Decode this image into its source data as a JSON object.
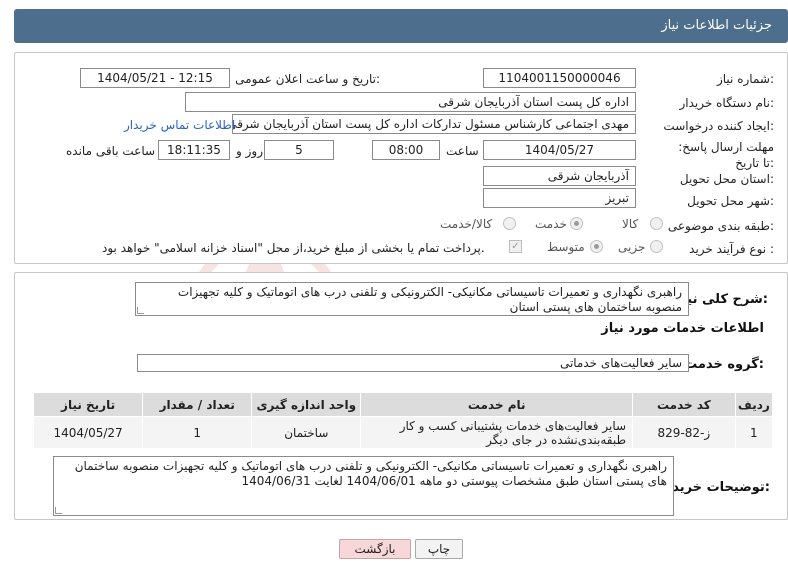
{
  "header": {
    "title": "جزئیات اطلاعات نیاز"
  },
  "form": {
    "need_number_label": "شماره نیاز:",
    "need_number": "1104001150000046",
    "announce_label": "تاریخ و ساعت اعلان عمومی:",
    "announce_value": "1404/05/21 - 12:15",
    "buyer_org_label": "نام دستگاه خریدار:",
    "buyer_org": "اداره کل پست استان آذربایجان شرقی",
    "requester_label": "ایجاد کننده درخواست:",
    "requester": "مهدی اجتماعی کارشناس مسئول تدارکات اداره کل پست استان آذربایجان شرقی",
    "buyer_contact_link": "اطلاعات تماس خریدار",
    "deadline_label": "مهلت ارسال پاسخ: تا تاریخ:",
    "deadline_date": "1404/05/27",
    "time_label": "ساعت",
    "deadline_time": "08:00",
    "days_value": "5",
    "days_label": "روز و",
    "remaining_time": "18:11:35",
    "remaining_label": "ساعت باقی مانده",
    "province_label": "استان محل تحویل:",
    "province": "آذربایجان شرقی",
    "city_label": "شهر محل تحویل:",
    "city": "تبریز",
    "category_label": "طبقه بندی موضوعی:",
    "category_options": [
      "کالا",
      "خدمت",
      "کالا/خدمت"
    ],
    "category_selected": "خدمت",
    "process_label": "نوع فرآیند خرید :",
    "process_options": [
      "جزیی",
      "متوسط"
    ],
    "process_selected": "متوسط",
    "payment_note": "پرداخت تمام یا بخشی از مبلغ خرید،از محل \"اسناد خزانه اسلامی\" خواهد بود."
  },
  "summary": {
    "label": "شرح کلی نیاز:",
    "text": "راهبری  نگهداری و تعمیرات تاسیساتی مکانیکی- الکترونیکی و تلفنی  درب های اتوماتیک و کلیه تجهیزات منصوبه ساختمان های پستی استان"
  },
  "services": {
    "section_title": "اطلاعات خدمات مورد نیاز",
    "group_label": "گروه خدمت:",
    "group_value": "سایر فعالیت‌های خدماتی",
    "columns": [
      "ردیف",
      "کد خدمت",
      "نام خدمت",
      "واحد اندازه گیری",
      "تعداد / مقدار",
      "تاریخ نیاز"
    ],
    "rows": [
      [
        "1",
        "ز-82-829",
        "سایر فعالیت‌های خدمات پشتیبانی کسب و کار طبقه‌بندی‌نشده در جای دیگر",
        "ساختمان",
        "1",
        "1404/05/27"
      ]
    ]
  },
  "buyer_notes": {
    "label": "توضیحات خریدار:",
    "text": "راهبری  نگهداری و تعمیرات تاسیساتی مکانیکی- الکترونیکی و تلفنی  درب های اتوماتیک و کلیه تجهیزات منصوبه ساختمان های پستی استان طبق مشخصات پیوستی دو ماهه 1404/06/01 لغایت 1404/06/31"
  },
  "buttons": {
    "print": "چاپ",
    "back": "بازگشت"
  },
  "watermark": {
    "text": "AriaTender.neT"
  },
  "colors": {
    "header": "#4d6e8c",
    "link": "#2a63c6",
    "back_button": "#f7d7d7"
  }
}
